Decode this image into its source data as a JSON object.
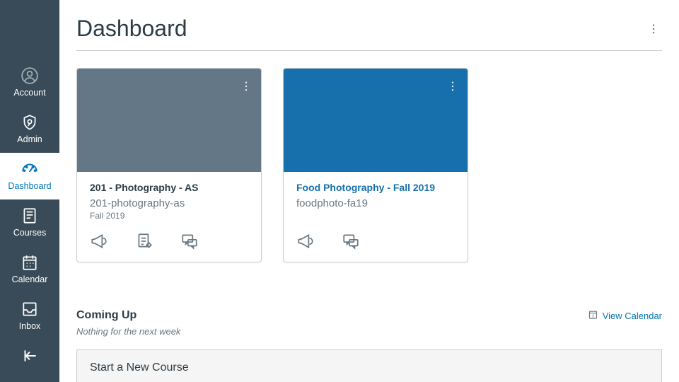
{
  "sidebar": {
    "items": [
      {
        "label": "Account"
      },
      {
        "label": "Admin"
      },
      {
        "label": "Dashboard"
      },
      {
        "label": "Courses"
      },
      {
        "label": "Calendar"
      },
      {
        "label": "Inbox"
      }
    ]
  },
  "header": {
    "title": "Dashboard"
  },
  "cards": [
    {
      "title": "201 - Photography - AS",
      "code": "201-photography-as",
      "term": "Fall 2019",
      "color": "#647787"
    },
    {
      "title": "Food Photography - Fall 2019",
      "code": "foodphoto-fa19",
      "term": "",
      "color": "#1770ab"
    }
  ],
  "coming_up": {
    "heading": "Coming Up",
    "empty_text": "Nothing for the next week",
    "view_calendar_label": "View Calendar"
  },
  "start_course": {
    "label": "Start a New Course"
  }
}
